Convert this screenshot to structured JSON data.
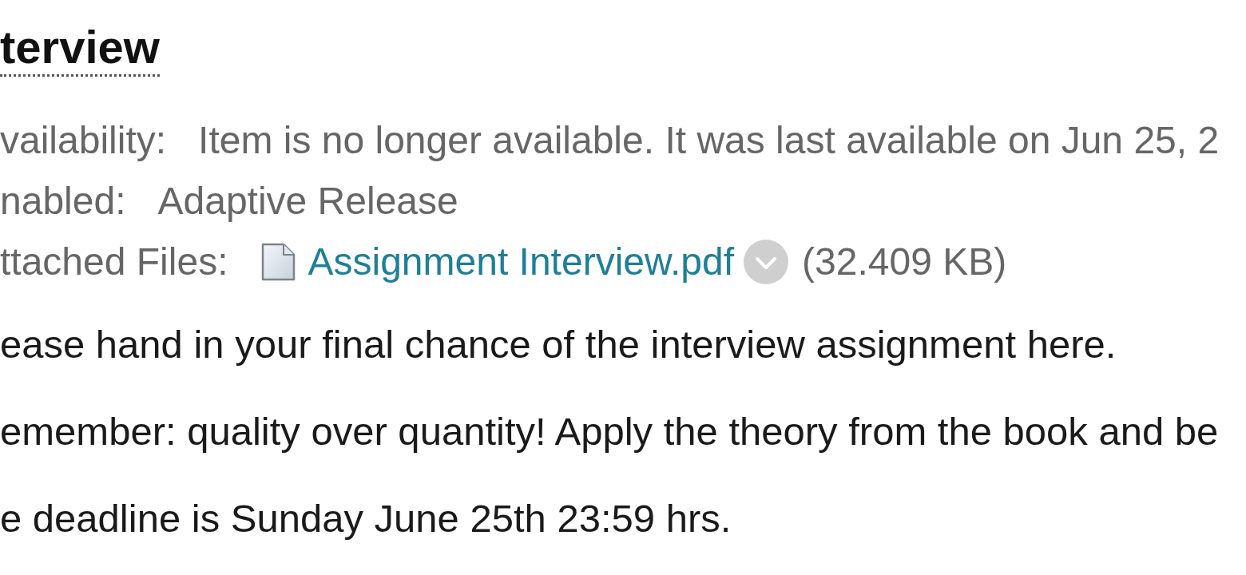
{
  "item": {
    "title": "terview",
    "details": [
      {
        "kind": "text",
        "label": "vailability:",
        "value": "Item is no longer available. It was last available on Jun 25, 2"
      },
      {
        "kind": "text",
        "label": "nabled:",
        "value": "Adaptive Release"
      },
      {
        "kind": "files",
        "label": "ttached Files:",
        "files": [
          {
            "name": "Assignment Interview.pdf",
            "size": "(32.409 KB)"
          }
        ]
      }
    ],
    "body": [
      "ease hand in your final chance of the interview assignment here.",
      "emember: quality over quantity! Apply the theory from the book and be",
      "e deadline is Sunday June 25th 23:59 hrs."
    ]
  }
}
